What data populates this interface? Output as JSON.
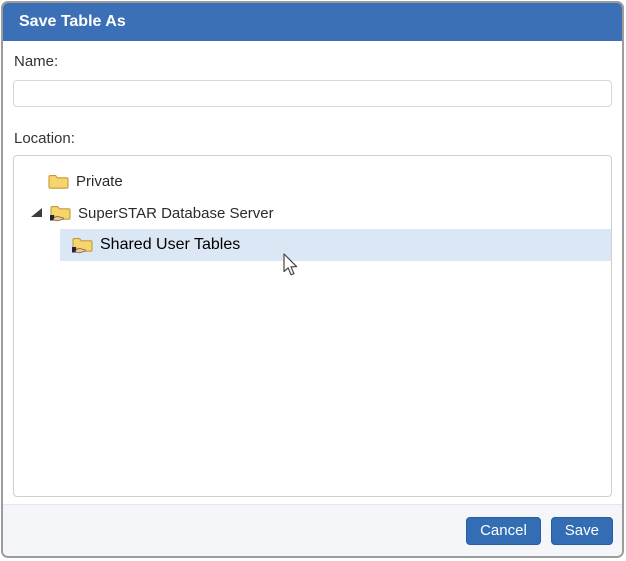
{
  "dialog": {
    "title": "Save Table As"
  },
  "form": {
    "name_label": "Name:",
    "name_value": "",
    "location_label": "Location:"
  },
  "tree": {
    "items": [
      {
        "label": "Private",
        "icon": "folder-icon",
        "level": 1,
        "expanded": false,
        "selected": false
      },
      {
        "label": "SuperSTAR Database Server",
        "icon": "shared-folder-icon",
        "level": 1,
        "expanded": true,
        "selected": false
      },
      {
        "label": "Shared User Tables",
        "icon": "shared-folder-icon",
        "level": 2,
        "expanded": false,
        "selected": true
      }
    ]
  },
  "footer": {
    "cancel_label": "Cancel",
    "save_label": "Save"
  },
  "colors": {
    "titlebar_blue": "#3b6fb6",
    "button_blue": "#336db4",
    "selection_highlight": "#dbe7f4",
    "folder_yellow": "#f6d56f",
    "folder_border": "#c39b35"
  }
}
